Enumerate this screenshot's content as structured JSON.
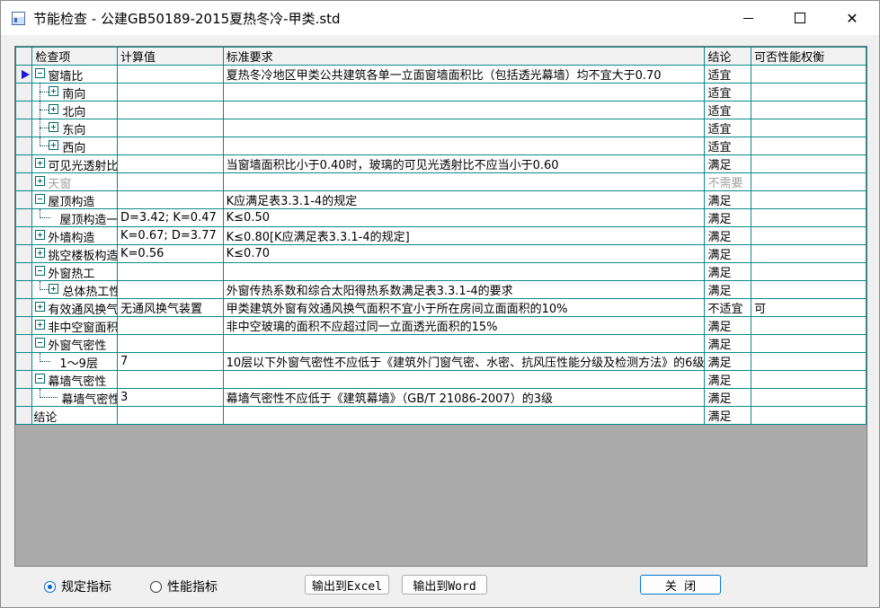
{
  "window": {
    "title": "节能检查 - 公建GB50189-2015夏热冬冷-甲类.std"
  },
  "table": {
    "headers": [
      "检查项",
      "计算值",
      "标准要求",
      "结论",
      "可否性能权衡"
    ],
    "rows": [
      {
        "item": "窗墙比",
        "calc": "",
        "req": "夏热冬冷地区甲类公共建筑各单一立面窗墙面积比（包括透光幕墙）均不宜大于0.70",
        "result": "适宜",
        "tradeoff": "",
        "current": true
      },
      {
        "item": "南向",
        "calc": "",
        "req": "",
        "result": "适宜",
        "tradeoff": ""
      },
      {
        "item": "北向",
        "calc": "",
        "req": "",
        "result": "适宜",
        "tradeoff": ""
      },
      {
        "item": "东向",
        "calc": "",
        "req": "",
        "result": "适宜",
        "tradeoff": ""
      },
      {
        "item": "西向",
        "calc": "",
        "req": "",
        "result": "适宜",
        "tradeoff": ""
      },
      {
        "item": "可见光透射比",
        "calc": "",
        "req": "当窗墙面积比小于0.40时，玻璃的可见光透射比不应当小于0.60",
        "result": "满足",
        "tradeoff": ""
      },
      {
        "item": "天窗",
        "calc": "",
        "req": "",
        "result": "不需要",
        "tradeoff": "",
        "muted": true
      },
      {
        "item": "屋顶构造",
        "calc": "",
        "req": "K应满足表3.3.1-4的规定",
        "result": "满足",
        "tradeoff": ""
      },
      {
        "item": "屋顶构造一",
        "calc": "D=3.42; K=0.47",
        "req": "K≤0.50",
        "result": "满足",
        "tradeoff": ""
      },
      {
        "item": "外墙构造",
        "calc": "K=0.67; D=3.77",
        "req": "K≤0.80[K应满足表3.3.1-4的规定]",
        "result": "满足",
        "tradeoff": ""
      },
      {
        "item": "挑空楼板构造",
        "calc": "K=0.56",
        "req": "K≤0.70",
        "result": "满足",
        "tradeoff": ""
      },
      {
        "item": "外窗热工",
        "calc": "",
        "req": "",
        "result": "满足",
        "tradeoff": ""
      },
      {
        "item": "总体热工性能",
        "calc": "",
        "req": "外窗传热系数和综合太阳得热系数满足表3.3.1-4的要求",
        "result": "满足",
        "tradeoff": ""
      },
      {
        "item": "有效通风换气面积",
        "calc": "无通风换气装置",
        "req": "甲类建筑外窗有效通风换气面积不宜小于所在房间立面面积的10%",
        "result": "不适宜",
        "tradeoff": "可"
      },
      {
        "item": "非中空窗面积比",
        "calc": "",
        "req": "非中空玻璃的面积不应超过同一立面透光面积的15%",
        "result": "满足",
        "tradeoff": ""
      },
      {
        "item": "外窗气密性",
        "calc": "",
        "req": "",
        "result": "满足",
        "tradeoff": ""
      },
      {
        "item": "1～9层",
        "calc": "7",
        "req": "10层以下外窗气密性不应低于《建筑外门窗气密、水密、抗风压性能分级及检测方法》的6级",
        "result": "满足",
        "tradeoff": ""
      },
      {
        "item": "幕墙气密性",
        "calc": "",
        "req": "",
        "result": "满足",
        "tradeoff": ""
      },
      {
        "item": "幕墙气密性",
        "calc": "3",
        "req": "幕墙气密性不应低于《建筑幕墙》（GB/T 21086-2007）的3级",
        "result": "满足",
        "tradeoff": ""
      },
      {
        "item": "结论",
        "calc": "",
        "req": "",
        "result": "满足",
        "tradeoff": ""
      }
    ]
  },
  "options": {
    "radio1": "规定指标",
    "radio2": "性能指标"
  },
  "buttons": {
    "export_excel": "输出到Excel",
    "export_word": "输出到Word",
    "close": "关  闭"
  }
}
